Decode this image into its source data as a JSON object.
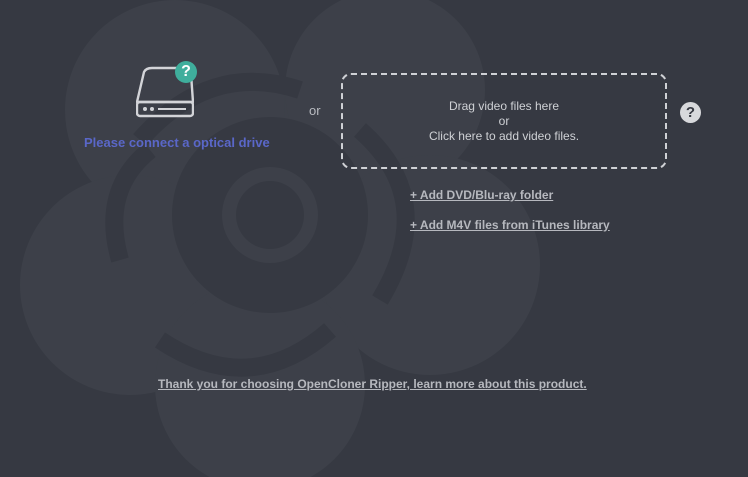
{
  "drive": {
    "help_badge": "?",
    "label": "Please connect a optical drive"
  },
  "separator": "or",
  "drop_zone": {
    "line1": "Drag video files here",
    "line2": "or",
    "line3": "Click here to add video files."
  },
  "help_icon": "?",
  "links": {
    "add_dvd": "+ Add DVD/Blu-ray folder",
    "add_m4v": "+ Add M4V files from iTunes library",
    "footer": "Thank you for choosing OpenCloner Ripper, learn more about this product."
  },
  "colors": {
    "background": "#363942",
    "drive_label": "#5a67c8",
    "help_badge": "#3fae9c"
  },
  "icons": {
    "drive": "optical-drive-icon",
    "drive_help": "question-badge-icon",
    "help": "help-icon"
  }
}
